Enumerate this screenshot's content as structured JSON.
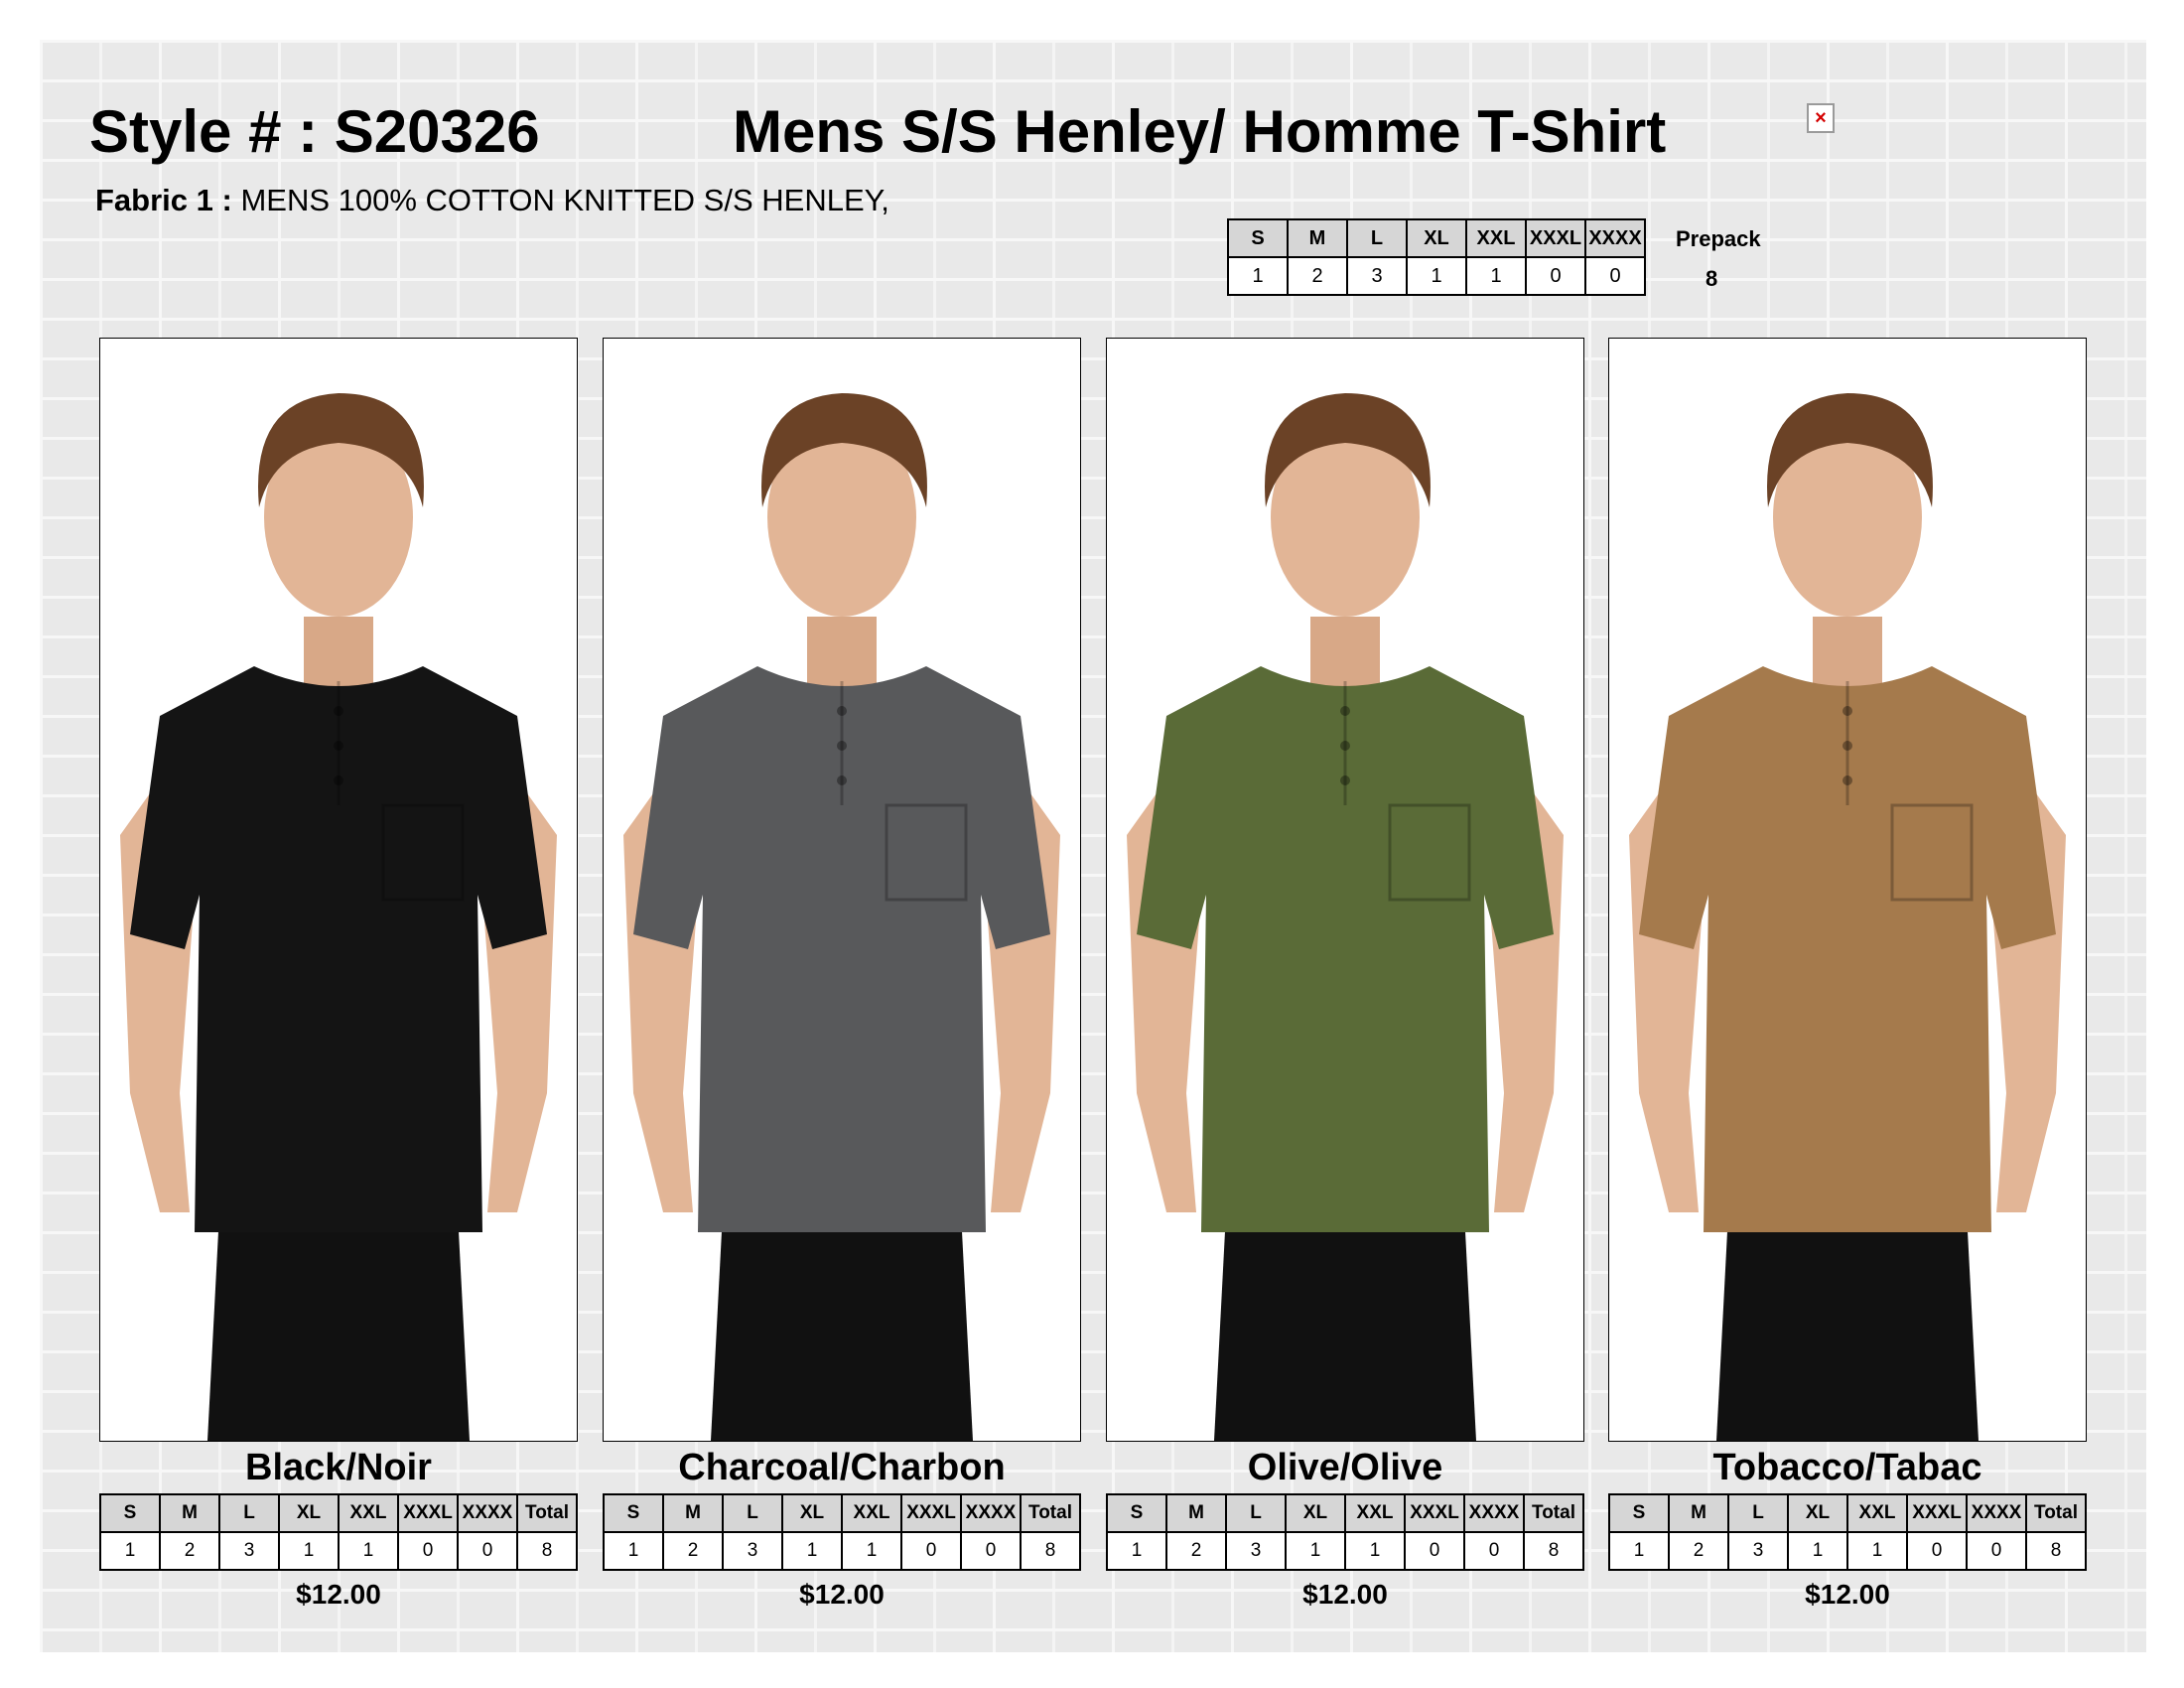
{
  "header": {
    "style_label": "Style # : S20326",
    "title": "Mens S/S  Henley/ Homme T-Shirt",
    "fabric_label": "Fabric 1 :",
    "fabric_value": "MENS 100% COTTON KNITTED S/S HENLEY,"
  },
  "prepack": {
    "sizes": [
      "S",
      "M",
      "L",
      "XL",
      "XXL",
      "XXXL",
      "XXXX"
    ],
    "qty": [
      "1",
      "2",
      "3",
      "1",
      "1",
      "0",
      "0"
    ],
    "label": "Prepack",
    "value": "8"
  },
  "products": [
    {
      "color_name": "Black/Noir",
      "shirt_color": "#141414",
      "headers": [
        "S",
        "M",
        "L",
        "XL",
        "XXL",
        "XXXL",
        "XXXX",
        "Total"
      ],
      "qty": [
        "1",
        "2",
        "3",
        "1",
        "1",
        "0",
        "0",
        "8"
      ],
      "price": "$12.00"
    },
    {
      "color_name": "Charcoal/Charbon",
      "shirt_color": "#58595b",
      "headers": [
        "S",
        "M",
        "L",
        "XL",
        "XXL",
        "XXXL",
        "XXXX",
        "Total"
      ],
      "qty": [
        "1",
        "2",
        "3",
        "1",
        "1",
        "0",
        "0",
        "8"
      ],
      "price": "$12.00"
    },
    {
      "color_name": "Olive/Olive",
      "shirt_color": "#5a6b37",
      "headers": [
        "S",
        "M",
        "L",
        "XL",
        "XXL",
        "XXXL",
        "XXXX",
        "Total"
      ],
      "qty": [
        "1",
        "2",
        "3",
        "1",
        "1",
        "0",
        "0",
        "8"
      ],
      "price": "$12.00"
    },
    {
      "color_name": "Tobacco/Tabac",
      "shirt_color": "#a57a4c",
      "headers": [
        "S",
        "M",
        "L",
        "XL",
        "XXL",
        "XXXL",
        "XXXX",
        "Total"
      ],
      "qty": [
        "1",
        "2",
        "3",
        "1",
        "1",
        "0",
        "0",
        "8"
      ],
      "price": "$12.00"
    }
  ]
}
